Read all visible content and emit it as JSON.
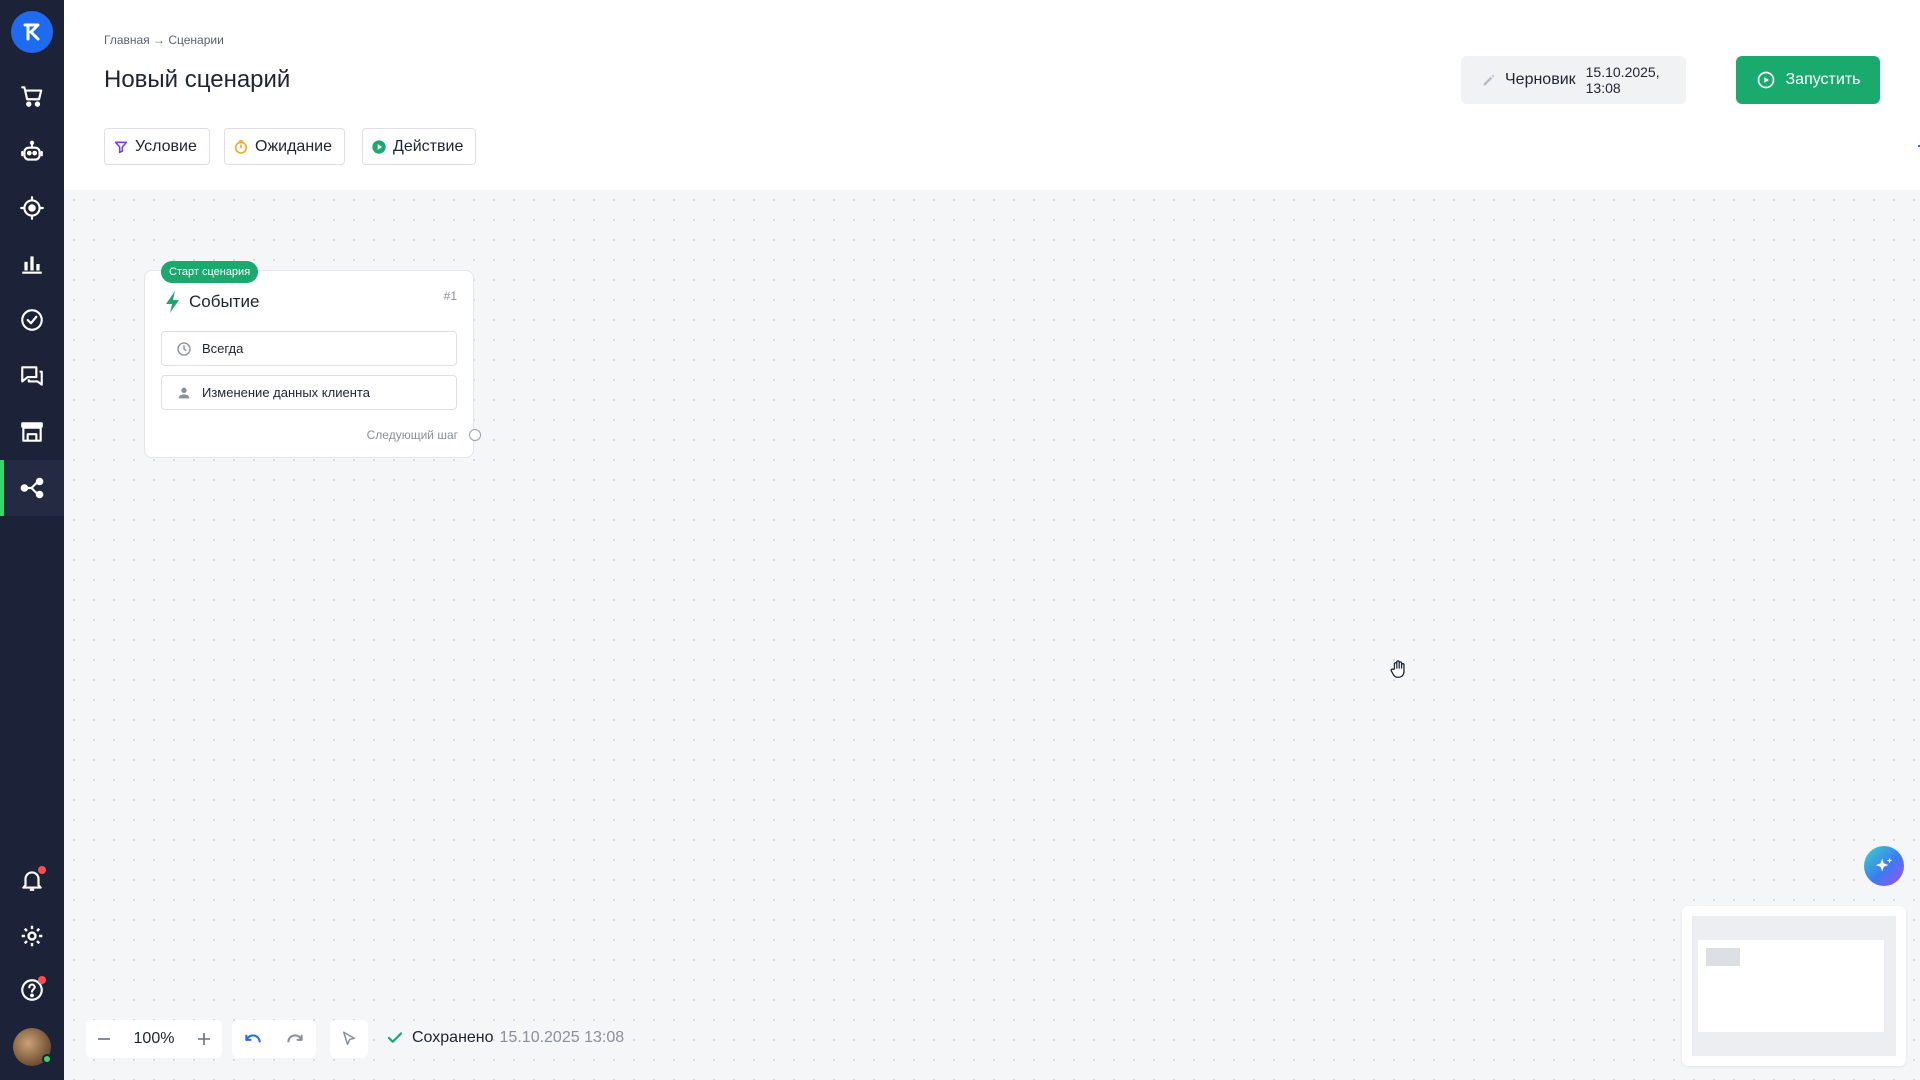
{
  "header": {
    "breadcrumb": "Главная → Сценарии",
    "title": "Новый сценарий",
    "status": {
      "label": "Черновик",
      "date": "15.10.2025, 13:08"
    },
    "run_label": "Запустить",
    "tools": [
      {
        "label": "Условие",
        "icon": "filter-icon",
        "color": "#7b3fe4"
      },
      {
        "label": "Ожидание",
        "icon": "timer-icon",
        "color": "#f5a623"
      },
      {
        "label": "Действие",
        "icon": "play-circle-icon",
        "color": "#1aaa6e"
      }
    ]
  },
  "sidebar": {
    "items": [
      {
        "name": "cart-icon"
      },
      {
        "name": "bot-icon"
      },
      {
        "name": "target-icon"
      },
      {
        "name": "chart-icon"
      },
      {
        "name": "check-circle-icon"
      },
      {
        "name": "chat-icon"
      },
      {
        "name": "store-icon"
      },
      {
        "name": "scenarios-icon",
        "active": true
      },
      {
        "name": "bell-icon"
      },
      {
        "name": "gear-icon"
      },
      {
        "name": "help-icon"
      }
    ]
  },
  "node": {
    "badge": "Старт сценария",
    "title": "Событие",
    "number": "#1",
    "rows": [
      {
        "label": "Всегда",
        "icon": "clock-icon"
      },
      {
        "label": "Изменение данных клиента",
        "icon": "person-icon"
      }
    ],
    "next": "Следующий шаг"
  },
  "footer": {
    "zoom": "100%",
    "saved_label": "Сохранено",
    "saved_date": "15.10.2025 13:08"
  },
  "colors": {
    "accent": "#1aaa6e",
    "sidebar": "#1c2237",
    "active_indicator": "#37d66c",
    "link_blue": "#1f6bf0"
  }
}
